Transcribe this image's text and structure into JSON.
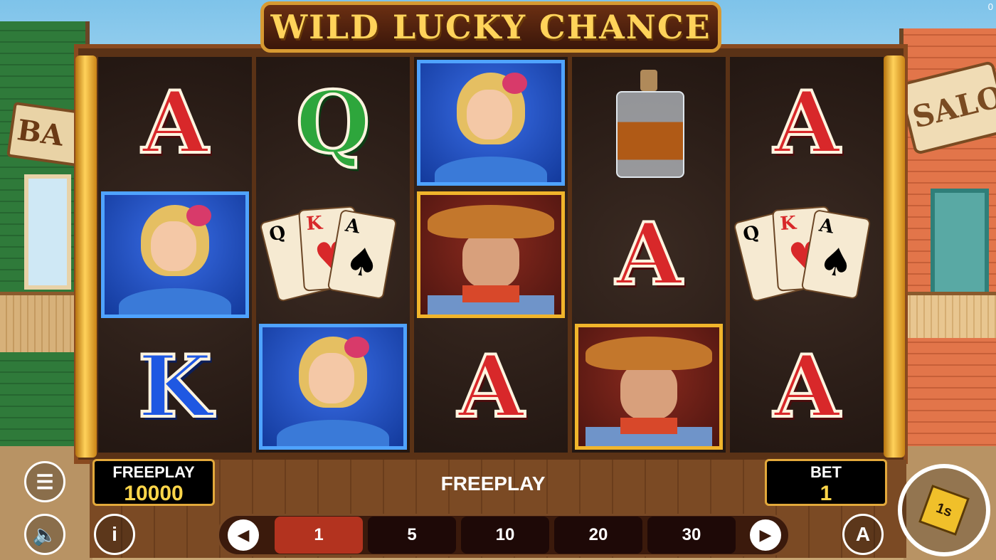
{
  "game": {
    "title": "WILD LUCKY CHANCE",
    "corner_counter": "0"
  },
  "background": {
    "left_sign": "BA",
    "right_sign": "SALOO"
  },
  "reels": [
    [
      "A",
      "lady",
      "K"
    ],
    [
      "Q",
      "cards",
      "lady"
    ],
    [
      "lady",
      "cowboy",
      "A"
    ],
    [
      "whiskey",
      "A",
      "cowboy"
    ],
    [
      "A",
      "cards",
      "A"
    ]
  ],
  "symbols": {
    "letter_A": "A",
    "letter_K": "K",
    "letter_Q": "Q",
    "card_q": "Q",
    "card_k": "K",
    "card_a": "A"
  },
  "balance": {
    "label": "FREEPLAY",
    "value": "10000"
  },
  "status_text": "FREEPLAY",
  "bet": {
    "label": "BET",
    "value": "1",
    "options": [
      "1",
      "5",
      "10",
      "20",
      "30"
    ],
    "selected": "1"
  },
  "buttons": {
    "menu_icon": "hamburger-icon",
    "sound_icon": "speaker-icon",
    "info_label": "i",
    "autoplay_label": "A",
    "spin_cube_label": "1s"
  },
  "colors": {
    "accent_gold": "#e3a93b",
    "selected_bet": "#b3331f",
    "title_text": "#ffd35a"
  }
}
